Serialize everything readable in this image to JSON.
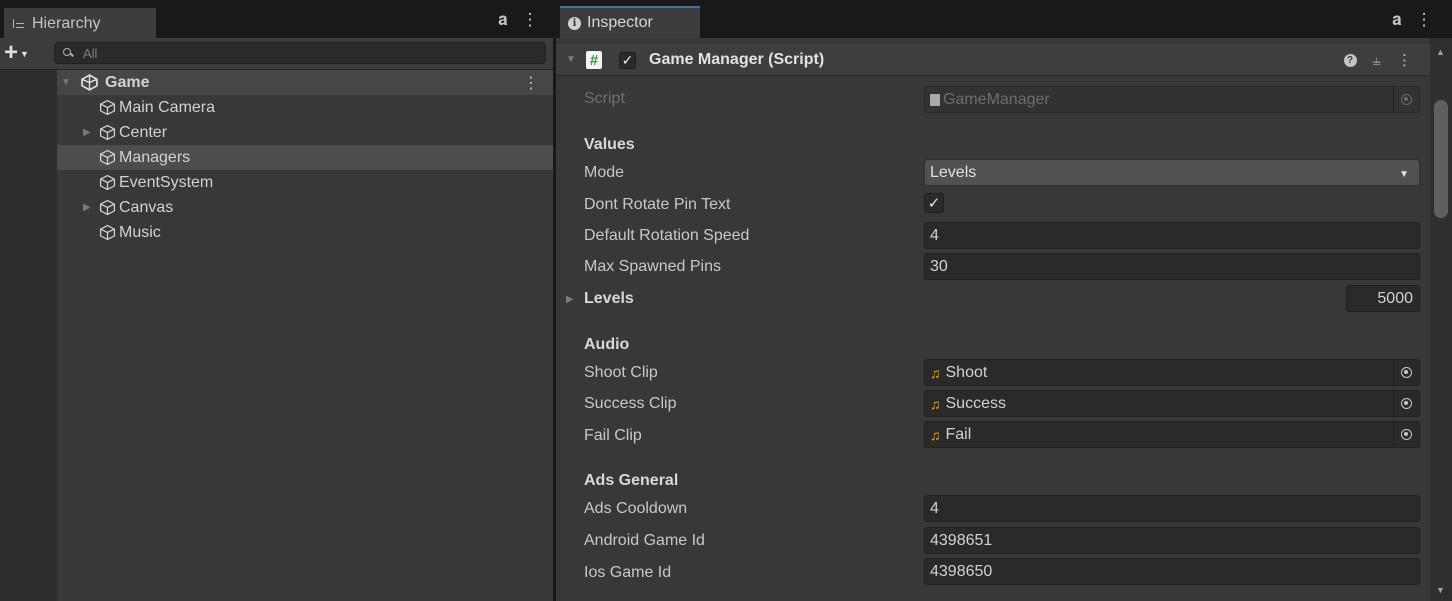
{
  "hierarchy": {
    "tab_title": "Hierarchy",
    "search_placeholder": "All",
    "scene": "Game",
    "items": [
      {
        "label": "Main Camera",
        "has_children": false
      },
      {
        "label": "Center",
        "has_children": true
      },
      {
        "label": "Managers",
        "has_children": false,
        "selected": true
      },
      {
        "label": "EventSystem",
        "has_children": false
      },
      {
        "label": "Canvas",
        "has_children": true
      },
      {
        "label": "Music",
        "has_children": false
      }
    ]
  },
  "inspector": {
    "tab_title": "Inspector",
    "component": {
      "title": "Game Manager (Script)",
      "enabled": true,
      "script_label": "Script",
      "script_value": "GameManager"
    },
    "values": {
      "header": "Values",
      "mode_label": "Mode",
      "mode_value": "Levels",
      "dont_rotate_label": "Dont Rotate Pin Text",
      "dont_rotate_checked": true,
      "rotation_speed_label": "Default Rotation Speed",
      "rotation_speed_value": "4",
      "max_pins_label": "Max Spawned Pins",
      "max_pins_value": "30",
      "levels_label": "Levels",
      "levels_size": "5000"
    },
    "audio": {
      "header": "Audio",
      "shoot_label": "Shoot Clip",
      "shoot_value": "Shoot",
      "success_label": "Success Clip",
      "success_value": "Success",
      "fail_label": "Fail Clip",
      "fail_value": "Fail"
    },
    "ads": {
      "header": "Ads General",
      "cooldown_label": "Ads Cooldown",
      "cooldown_value": "4",
      "android_label": "Android Game Id",
      "android_value": "4398651",
      "ios_label": "Ios Game Id",
      "ios_value": "4398650"
    }
  },
  "icons": {
    "hierarchy_tab": "hierarchy-list-icon",
    "lock": "lock-icon",
    "menu": "kebab-menu-icon",
    "add": "plus-icon",
    "search": "search-icon",
    "unity_scene": "unity-logo-icon",
    "game_object": "cube-icon",
    "inspector_tab": "info-icon",
    "script": "csharp-script-icon",
    "help": "help-icon",
    "presets": "sliders-icon",
    "object_picker": "object-picker-icon",
    "audio_clip": "music-note-icon"
  }
}
